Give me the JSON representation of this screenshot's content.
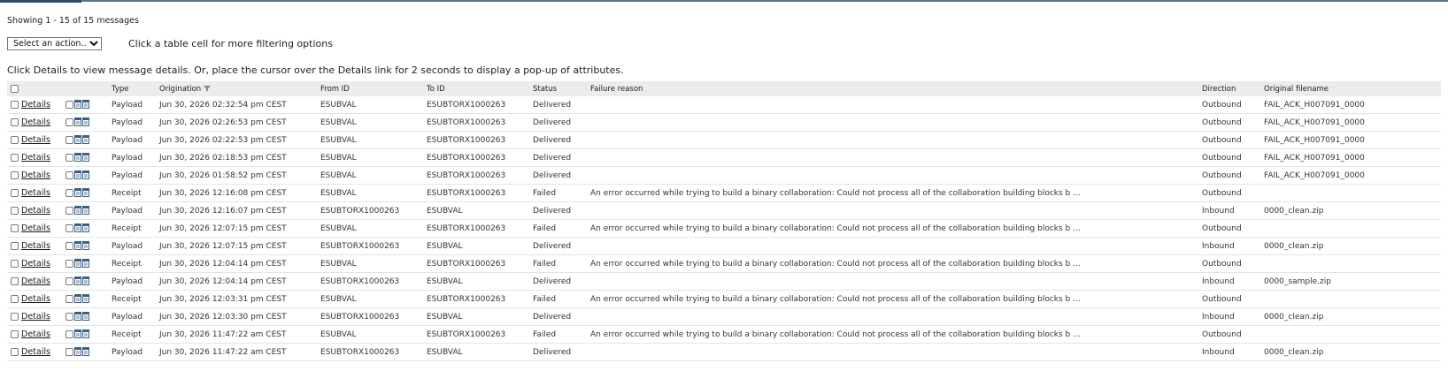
{
  "summary": {
    "showing": "Showing 1 - 15 of 15  messages"
  },
  "toolbar": {
    "action_select": "Select an action...",
    "filter_hint": "Click a table cell for more filtering options",
    "details_hint": "Click Details to view message details. Or, place the cursor over the Details link for 2 seconds to display a pop-up of attributes."
  },
  "table": {
    "columns": {
      "type": "Type",
      "origination": "Origination",
      "from_id": "From ID",
      "to_id": "To ID",
      "status": "Status",
      "failure_reason": "Failure reason",
      "direction": "Direction",
      "original_filename": "Original filename"
    },
    "details_label": "Details",
    "rows": [
      {
        "type": "Payload",
        "origination": "Jun 30, 2026 02:32:54 pm CEST",
        "from_id": "ESUBVAL",
        "to_id": "ESUBTORX1000263",
        "status": "Delivered",
        "failure_reason": "",
        "direction": "Outbound",
        "original_filename": "FAIL_ACK_H007091_0000"
      },
      {
        "type": "Payload",
        "origination": "Jun 30, 2026 02:26:53 pm CEST",
        "from_id": "ESUBVAL",
        "to_id": "ESUBTORX1000263",
        "status": "Delivered",
        "failure_reason": "",
        "direction": "Outbound",
        "original_filename": "FAIL_ACK_H007091_0000"
      },
      {
        "type": "Payload",
        "origination": "Jun 30, 2026 02:22:53 pm CEST",
        "from_id": "ESUBVAL",
        "to_id": "ESUBTORX1000263",
        "status": "Delivered",
        "failure_reason": "",
        "direction": "Outbound",
        "original_filename": "FAIL_ACK_H007091_0000"
      },
      {
        "type": "Payload",
        "origination": "Jun 30, 2026 02:18:53 pm CEST",
        "from_id": "ESUBVAL",
        "to_id": "ESUBTORX1000263",
        "status": "Delivered",
        "failure_reason": "",
        "direction": "Outbound",
        "original_filename": "FAIL_ACK_H007091_0000"
      },
      {
        "type": "Payload",
        "origination": "Jun 30, 2026 01:58:52 pm CEST",
        "from_id": "ESUBVAL",
        "to_id": "ESUBTORX1000263",
        "status": "Delivered",
        "failure_reason": "",
        "direction": "Outbound",
        "original_filename": "FAIL_ACK_H007091_0000"
      },
      {
        "type": "Receipt",
        "origination": "Jun 30, 2026 12:16:08 pm CEST",
        "from_id": "ESUBVAL",
        "to_id": "ESUBTORX1000263",
        "status": "Failed",
        "failure_reason": "An error occurred while trying to build a binary collaboration: Could not process all of the collaboration building blocks b ...",
        "direction": "Outbound",
        "original_filename": ""
      },
      {
        "type": "Payload",
        "origination": "Jun 30, 2026 12:16:07 pm CEST",
        "from_id": "ESUBTORX1000263",
        "to_id": "ESUBVAL",
        "status": "Delivered",
        "failure_reason": "",
        "direction": "Inbound",
        "original_filename": "0000_clean.zip"
      },
      {
        "type": "Receipt",
        "origination": "Jun 30, 2026 12:07:15 pm CEST",
        "from_id": "ESUBVAL",
        "to_id": "ESUBTORX1000263",
        "status": "Failed",
        "failure_reason": "An error occurred while trying to build a binary collaboration: Could not process all of the collaboration building blocks b ...",
        "direction": "Outbound",
        "original_filename": ""
      },
      {
        "type": "Payload",
        "origination": "Jun 30, 2026 12:07:15 pm CEST",
        "from_id": "ESUBTORX1000263",
        "to_id": "ESUBVAL",
        "status": "Delivered",
        "failure_reason": "",
        "direction": "Inbound",
        "original_filename": "0000_clean.zip"
      },
      {
        "type": "Receipt",
        "origination": "Jun 30, 2026 12:04:14 pm CEST",
        "from_id": "ESUBVAL",
        "to_id": "ESUBTORX1000263",
        "status": "Failed",
        "failure_reason": "An error occurred while trying to build a binary collaboration: Could not process all of the collaboration building blocks b ...",
        "direction": "Outbound",
        "original_filename": ""
      },
      {
        "type": "Payload",
        "origination": "Jun 30, 2026 12:04:14 pm CEST",
        "from_id": "ESUBTORX1000263",
        "to_id": "ESUBVAL",
        "status": "Delivered",
        "failure_reason": "",
        "direction": "Inbound",
        "original_filename": "0000_sample.zip"
      },
      {
        "type": "Receipt",
        "origination": "Jun 30, 2026 12:03:31 pm CEST",
        "from_id": "ESUBVAL",
        "to_id": "ESUBTORX1000263",
        "status": "Failed",
        "failure_reason": "An error occurred while trying to build a binary collaboration: Could not process all of the collaboration building blocks b ...",
        "direction": "Outbound",
        "original_filename": ""
      },
      {
        "type": "Payload",
        "origination": "Jun 30, 2026 12:03:30 pm CEST",
        "from_id": "ESUBTORX1000263",
        "to_id": "ESUBVAL",
        "status": "Delivered",
        "failure_reason": "",
        "direction": "Inbound",
        "original_filename": "0000_clean.zip"
      },
      {
        "type": "Receipt",
        "origination": "Jun 30, 2026 11:47:22 am CEST",
        "from_id": "ESUBVAL",
        "to_id": "ESUBTORX1000263",
        "status": "Failed",
        "failure_reason": "An error occurred while trying to build a binary collaboration: Could not process all of the collaboration building blocks b ...",
        "direction": "Outbound",
        "original_filename": ""
      },
      {
        "type": "Payload",
        "origination": "Jun 30, 2026 11:47:22 am CEST",
        "from_id": "ESUBTORX1000263",
        "to_id": "ESUBVAL",
        "status": "Delivered",
        "failure_reason": "",
        "direction": "Inbound",
        "original_filename": "0000_clean.zip"
      }
    ]
  },
  "icons": {
    "row_icon": "document-pair-icon",
    "sort_icon": "filter-funnel-icon"
  }
}
